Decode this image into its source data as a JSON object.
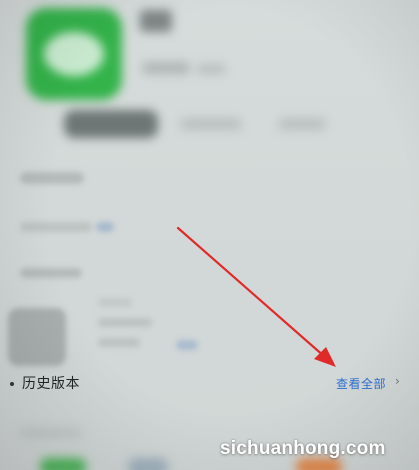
{
  "section": {
    "title": "历史版本",
    "view_all_label": "查看全部",
    "chevron_icon": "chevron-right-icon"
  },
  "app_icon": {
    "name": "wechat-icon",
    "color": "#33b34a"
  },
  "accent_color": "#2f6fd0",
  "annotation_arrow_color": "#e02a2a",
  "watermark": "sichuanhong.com"
}
